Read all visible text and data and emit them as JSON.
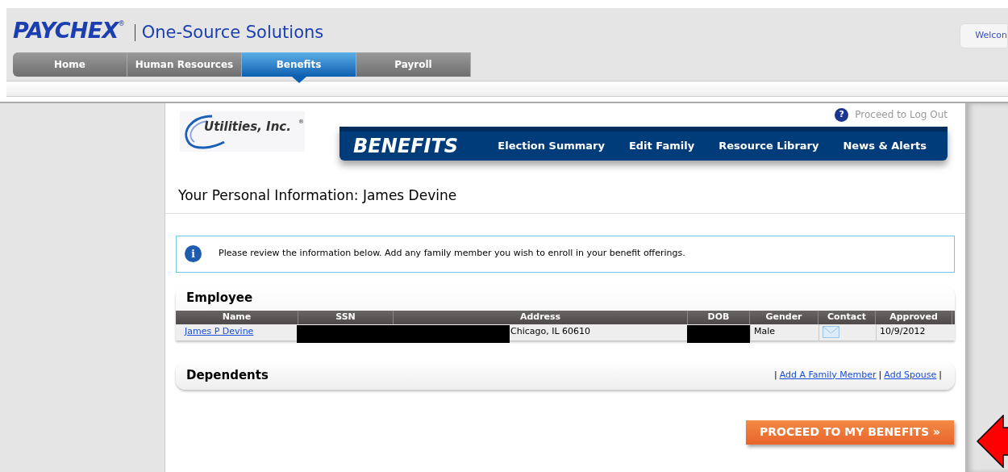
{
  "header": {
    "brand": "PAYCHEX",
    "brand_mark": "®",
    "product": "One-Source Solutions",
    "welcome": "Welcon"
  },
  "tabs": [
    {
      "label": "Home",
      "selected": false
    },
    {
      "label": "Human Resources",
      "selected": false
    },
    {
      "label": "Benefits",
      "selected": true
    },
    {
      "label": "Payroll",
      "selected": false
    }
  ],
  "company": {
    "name": "Utilities, Inc.",
    "mark": "®"
  },
  "logout": "Proceed to Log Out",
  "help_glyph": "?",
  "info_glyph": "i",
  "benefits_nav": {
    "title": "BENEFITS",
    "items": [
      "Election Summary",
      "Edit Family",
      "Resource Library",
      "News & Alerts"
    ]
  },
  "page_title": "Your Personal Information: James Devine",
  "notice": "Please review the information below. Add any family member you wish to enroll in your benefit offerings.",
  "employee": {
    "title": "Employee",
    "columns": [
      "Name",
      "SSN",
      "Address",
      "DOB",
      "Gender",
      "Contact",
      "Approved"
    ],
    "row": {
      "name": "James P Devine",
      "address": "Chicago, IL 60610",
      "gender": "Male",
      "approved": "10/9/2012"
    }
  },
  "dependents": {
    "title": "Dependents",
    "sep": "|",
    "links": [
      "Add A Family Member",
      "Add Spouse"
    ]
  },
  "proceed_button": "PROCEED TO MY BENEFITS »"
}
